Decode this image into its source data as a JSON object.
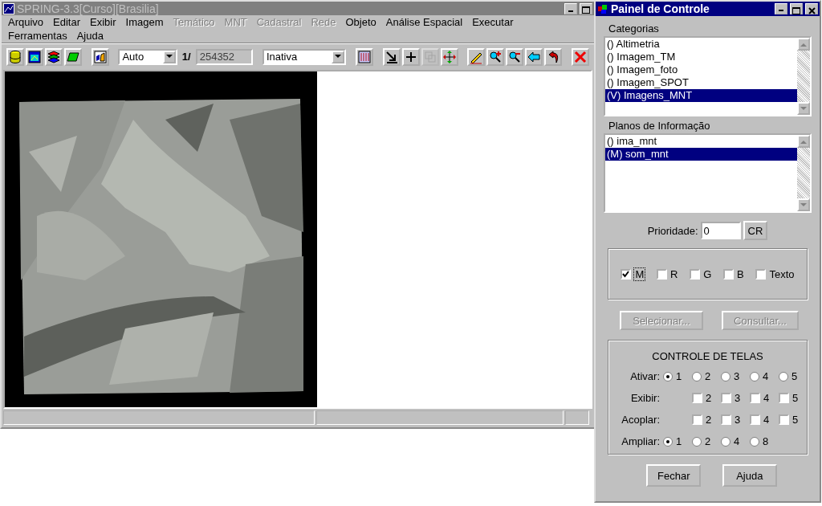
{
  "main_window": {
    "title": "SPRING-3.3[Curso][Brasilia]",
    "menu_rows": [
      [
        {
          "label": "Arquivo",
          "disabled": false
        },
        {
          "label": "Editar",
          "disabled": false
        },
        {
          "label": "Exibir",
          "disabled": false
        },
        {
          "label": "Imagem",
          "disabled": false
        },
        {
          "label": "Temático",
          "disabled": true
        },
        {
          "label": "MNT",
          "disabled": true
        },
        {
          "label": "Cadastral",
          "disabled": true
        },
        {
          "label": "Rede",
          "disabled": true
        },
        {
          "label": "Objeto",
          "disabled": false
        },
        {
          "label": "Análise Espacial",
          "disabled": false
        },
        {
          "label": "Executar",
          "disabled": false
        }
      ],
      [
        {
          "label": "Ferramentas",
          "disabled": false
        },
        {
          "label": "Ajuda",
          "disabled": false
        }
      ]
    ],
    "toolbar": {
      "tools_left": [
        {
          "disabled": false
        },
        {
          "disabled": false
        },
        {
          "disabled": false
        },
        {
          "disabled": false
        },
        {
          "disabled": false
        }
      ],
      "scale_select": "Auto",
      "scale_label": "1/",
      "scale_value": "254352",
      "mode_select": "Inativa",
      "tools_right": [
        {
          "disabled": false
        },
        {
          "disabled": false
        },
        {
          "disabled": false
        },
        {
          "disabled": true
        },
        {
          "disabled": false
        },
        {
          "disabled": false
        },
        {
          "disabled": false
        },
        {
          "disabled": false
        },
        {
          "disabled": false
        },
        {
          "disabled": false
        },
        {
          "disabled": false
        }
      ]
    }
  },
  "panel": {
    "title": "Painel de Controle",
    "categories": {
      "label": "Categorias",
      "items": [
        {
          "text": "() Altimetria",
          "selected": false
        },
        {
          "text": "() Imagem_TM",
          "selected": false
        },
        {
          "text": "() Imagem_foto",
          "selected": false
        },
        {
          "text": "() Imagem_SPOT",
          "selected": false
        },
        {
          "text": "(V) Imagens_MNT",
          "selected": true
        }
      ]
    },
    "planes": {
      "label": "Planos de Informação",
      "items": [
        {
          "text": "() ima_mnt",
          "selected": false
        },
        {
          "text": "(M) som_mnt",
          "selected": true
        }
      ]
    },
    "priority": {
      "label": "Prioridade:",
      "value": "0",
      "button": "CR"
    },
    "channels": [
      {
        "label": "M",
        "checked": true,
        "focused": true
      },
      {
        "label": "R",
        "checked": false,
        "focused": false
      },
      {
        "label": "G",
        "checked": false,
        "focused": false
      },
      {
        "label": "B",
        "checked": false,
        "focused": false
      },
      {
        "label": "Texto",
        "checked": false,
        "focused": false
      }
    ],
    "actions": [
      {
        "label": "Selecionar...",
        "disabled": true
      },
      {
        "label": "Consultar...",
        "disabled": true
      }
    ],
    "screen_control": {
      "title": "CONTROLE DE TELAS",
      "rows": [
        {
          "label": "Ativar:",
          "kind": "radio",
          "options": [
            {
              "label": "1",
              "selected": true
            },
            {
              "label": "2",
              "selected": false
            },
            {
              "label": "3",
              "selected": false
            },
            {
              "label": "4",
              "selected": false
            },
            {
              "label": "5",
              "selected": false
            }
          ]
        },
        {
          "label": "Exibir:",
          "kind": "check",
          "options": [
            {
              "label": "2",
              "checked": false
            },
            {
              "label": "3",
              "checked": false
            },
            {
              "label": "4",
              "checked": false
            },
            {
              "label": "5",
              "checked": false
            }
          ]
        },
        {
          "label": "Acoplar:",
          "kind": "check",
          "options": [
            {
              "label": "2",
              "checked": false
            },
            {
              "label": "3",
              "checked": false
            },
            {
              "label": "4",
              "checked": false
            },
            {
              "label": "5",
              "checked": false
            }
          ]
        },
        {
          "label": "Ampliar:",
          "kind": "radio",
          "options": [
            {
              "label": "1",
              "selected": true
            },
            {
              "label": "2",
              "selected": false
            },
            {
              "label": "4",
              "selected": false
            },
            {
              "label": "8",
              "selected": false
            }
          ]
        }
      ]
    },
    "buttons": [
      {
        "label": "Fechar"
      },
      {
        "label": "Ajuda"
      }
    ]
  }
}
